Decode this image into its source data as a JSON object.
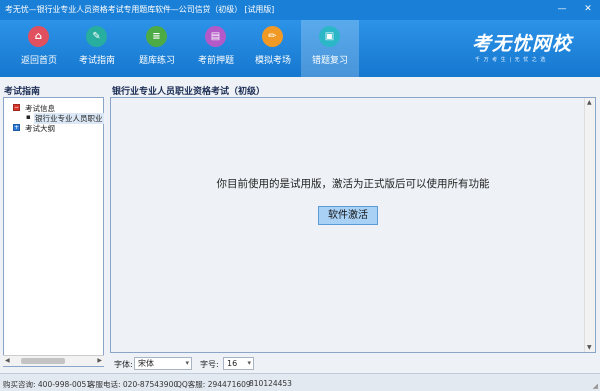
{
  "window": {
    "title": "考无忧—银行业专业人员资格考试专用题库软件—公司信贷（初级）  [试用版]",
    "minimize": "—",
    "close": "✕"
  },
  "toolbar": {
    "items": [
      {
        "label": "返回首页",
        "icon": "home-icon",
        "color": "#e0505e",
        "glyph": "⌂"
      },
      {
        "label": "考试指南",
        "icon": "compass-icon",
        "color": "#27ae9e",
        "glyph": "✎"
      },
      {
        "label": "题库练习",
        "icon": "list-icon",
        "color": "#4cab45",
        "glyph": "≡"
      },
      {
        "label": "考前押题",
        "icon": "document-icon",
        "color": "#b45ac8",
        "glyph": "▤"
      },
      {
        "label": "模拟考场",
        "icon": "pencil-icon",
        "color": "#f09a25",
        "glyph": "✏"
      },
      {
        "label": "错题复习",
        "icon": "clipboard-icon",
        "color": "#2bb7c8",
        "glyph": "▣"
      }
    ],
    "brand": "考无忧网校",
    "brand_sub": "千 万 考 生 | 无 忧 之 选"
  },
  "sidebar": {
    "title": "考试指南",
    "tree": [
      {
        "label": "考试信息",
        "expander": "−"
      },
      {
        "label": "银行业专业人员职业"
      },
      {
        "label": "考试大纲",
        "expander": "+"
      }
    ],
    "scroll_left": "◀",
    "scroll_right": "▶"
  },
  "main": {
    "title": "银行业专业人员职业资格考试（初级）",
    "message": "你目前使用的是试用版，激活为正式版后可以使用所有功能",
    "activate_button": "软件激活",
    "scroll_up": "▲",
    "scroll_down": "▼"
  },
  "font_bar": {
    "font_label": "字体:",
    "font_value": "宋体",
    "size_label": "字号:",
    "size_value": "16",
    "chevron": "▾"
  },
  "status_bar": {
    "purchase": "购买咨询: 400-998-0051",
    "service_phone": "客服电话: 020-87543900",
    "qq": "QQ客服: 294471609",
    "qq2": "810124453"
  }
}
